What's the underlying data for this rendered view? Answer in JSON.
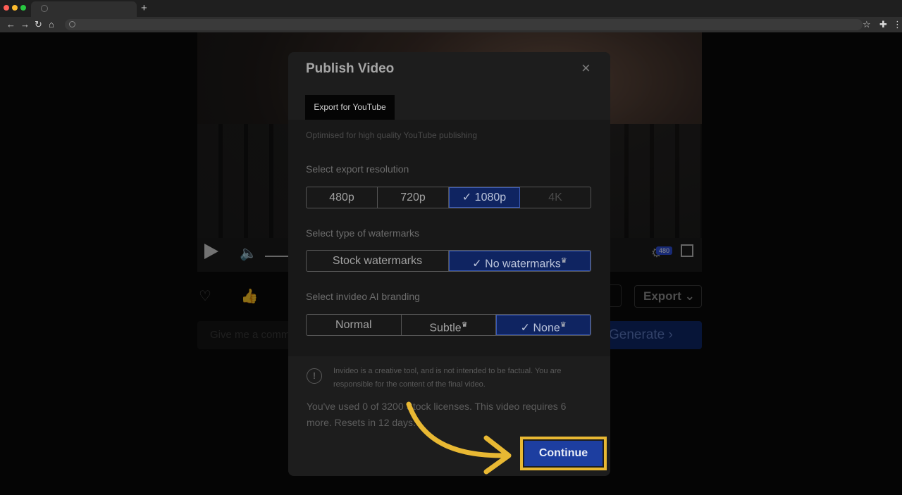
{
  "browser": {
    "new_tab": "+",
    "nav": {
      "back": "←",
      "forward": "→",
      "reload": "↻",
      "home": "⌂"
    },
    "star_icon": "☆",
    "menu_icon": "⋮"
  },
  "background_page": {
    "quality_badge": "480",
    "export_label": "Export",
    "prompt_placeholder": "Give me a comm",
    "generate_label": "Generate ›",
    "reactions": "♡ 👍 👎"
  },
  "modal": {
    "title": "Publish Video",
    "close_icon": "×",
    "tab_label": "Export for YouTube",
    "subtitle": "Optimised for high quality YouTube publishing",
    "resolution": {
      "label": "Select export resolution",
      "options": [
        "480p",
        "720p",
        "1080p",
        "4K"
      ],
      "selected": "1080p"
    },
    "watermarks": {
      "label": "Select type of watermarks",
      "options": [
        "Stock watermarks",
        "No watermarks"
      ],
      "selected": "No watermarks"
    },
    "branding": {
      "label": "Select invideo AI branding",
      "options": [
        "Normal",
        "Subtle",
        "None"
      ],
      "selected": "None"
    },
    "disclaimer": "Invideo is a creative tool, and is not intended to be factual. You are responsible for the content of the final video.",
    "usage_text": "You've used 0 of 3200 Stock licenses. This video requires 6 more. Resets in 12 days.",
    "continue_label": "Continue"
  },
  "colors": {
    "accent": "#1d3ea0",
    "highlight": "#e8b833",
    "selected_bg": "#0f2461"
  }
}
